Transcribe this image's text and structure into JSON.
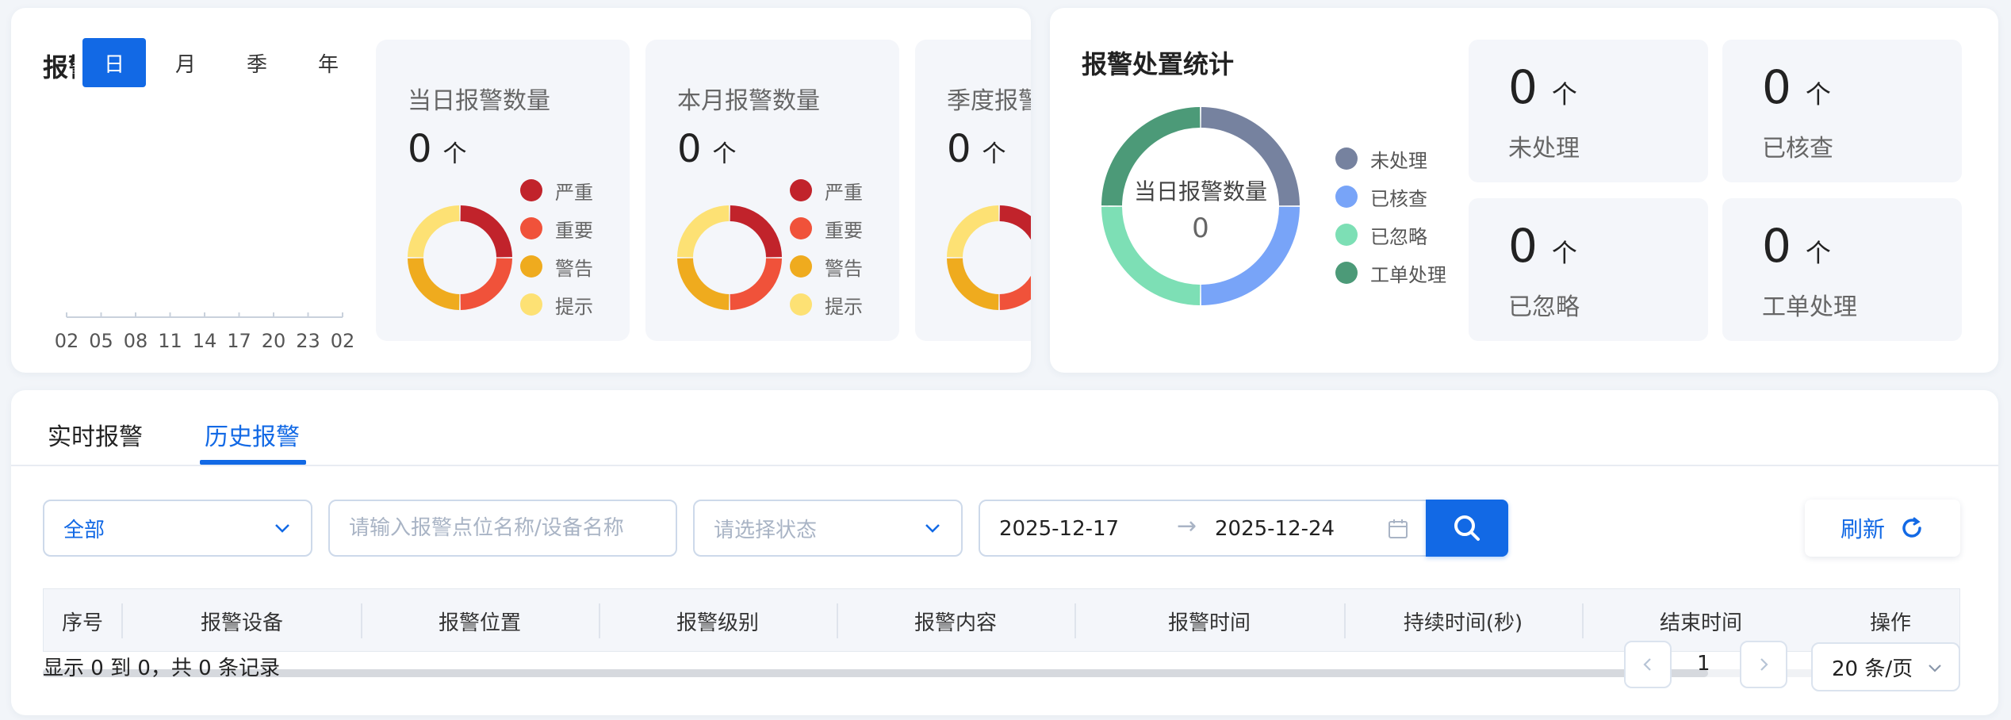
{
  "alarm_trend": {
    "title": "报警趋势",
    "periods": [
      "日",
      "月",
      "季",
      "年"
    ],
    "active_period": 0,
    "x_ticks": [
      "02",
      "05",
      "08",
      "11",
      "14",
      "17",
      "20",
      "23",
      "02"
    ]
  },
  "stat_cards": [
    {
      "title": "当日报警数量",
      "value": "0",
      "unit": "个"
    },
    {
      "title": "本月报警数量",
      "value": "0",
      "unit": "个"
    },
    {
      "title": "季度报警数量",
      "value": "0",
      "unit": "个"
    }
  ],
  "severity_legend": [
    {
      "label": "严重",
      "color": "#c1232b"
    },
    {
      "label": "重要",
      "color": "#f0523a"
    },
    {
      "label": "警告",
      "color": "#efab1e"
    },
    {
      "label": "提示",
      "color": "#fde174"
    }
  ],
  "disposal": {
    "title": "报警处置统计",
    "center_label": "当日报警数量",
    "center_value": "0",
    "legend": [
      {
        "label": "未处理",
        "color": "#76829f"
      },
      {
        "label": "已核查",
        "color": "#78a4f8"
      },
      {
        "label": "已忽略",
        "color": "#7ddfb5"
      },
      {
        "label": "工单处理",
        "color": "#4c9a78"
      }
    ],
    "cards": [
      {
        "value": "0",
        "unit": "个",
        "label": "未处理"
      },
      {
        "value": "0",
        "unit": "个",
        "label": "已核查"
      },
      {
        "value": "0",
        "unit": "个",
        "label": "已忽略"
      },
      {
        "value": "0",
        "unit": "个",
        "label": "工单处理"
      }
    ]
  },
  "tabs": [
    {
      "label": "实时报警"
    },
    {
      "label": "历史报警"
    }
  ],
  "active_tab": 1,
  "filters": {
    "type_value": "全部",
    "search_placeholder": "请输入报警点位名称/设备名称",
    "status_placeholder": "请选择状态",
    "date_start": "2025-12-17",
    "date_arrow": "→",
    "date_end": "2025-12-24",
    "refresh_label": "刷新"
  },
  "table": {
    "columns": [
      "序号",
      "报警设备",
      "报警位置",
      "报警级别",
      "报警内容",
      "报警时间",
      "持续时间(秒)",
      "结束时间",
      "操作"
    ],
    "rows": []
  },
  "pagination": {
    "records_info": "显示 0 到 0，共 0 条记录",
    "current_page": "1",
    "page_size": "20 条/页"
  }
}
